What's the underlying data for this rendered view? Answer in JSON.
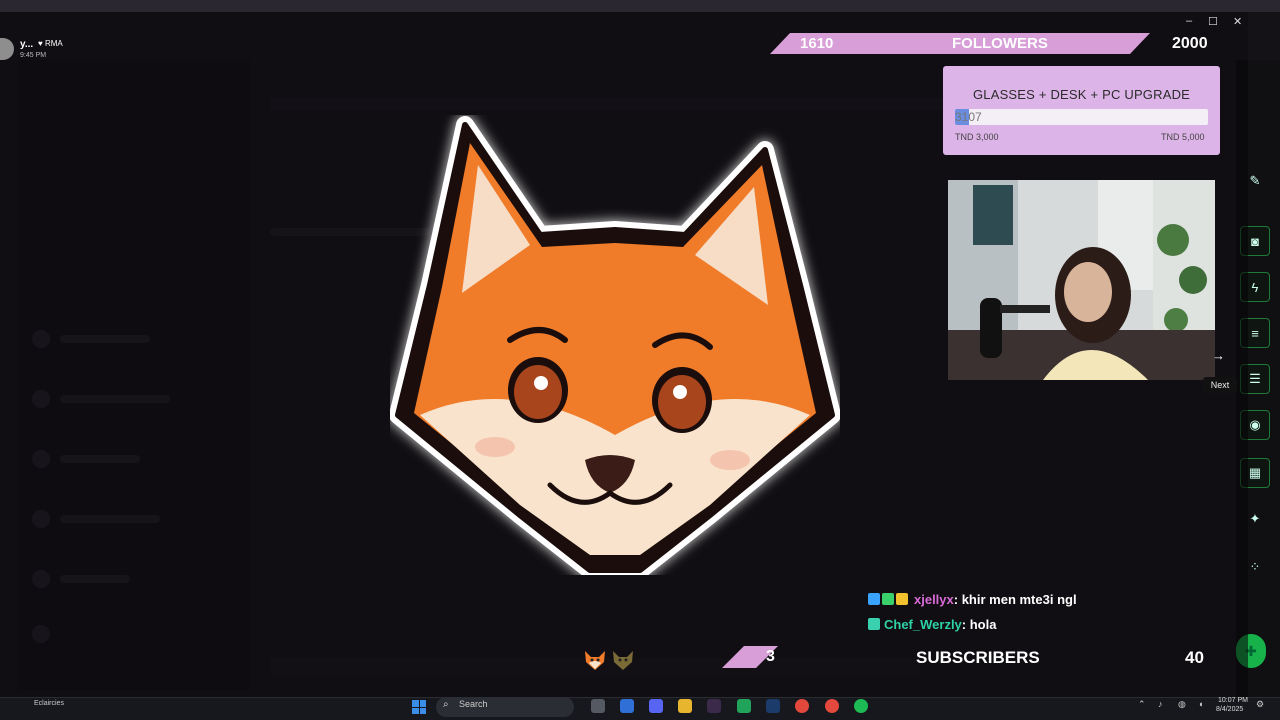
{
  "profile": {
    "name": "y...",
    "tag": "♥ RMA",
    "time": "9:45 PM"
  },
  "window_controls": {
    "minimize": "–",
    "maximize": "☐",
    "close": "✕"
  },
  "followers": {
    "current": "1610",
    "label": "FOLLOWERS",
    "goal": "2000",
    "color": "#d79ed8"
  },
  "goal_widget": {
    "title": "GLASSES + DESK + PC UPGRADE",
    "current": "3107",
    "progress": 0.0535,
    "min_label": "TND 3,000",
    "max_label": "TND 5,000",
    "bg": "#ddb4e8",
    "fill": "#6a8de0"
  },
  "webcam": {
    "next_label": "Next",
    "arrow": "→"
  },
  "chat": [
    {
      "user": "xjellyx",
      "message": ": khir men mte3i ngl",
      "user_color": "#d96bd7"
    },
    {
      "user": "Chef_Werzly",
      "message": ": hola",
      "user_color": "#2fd1a6"
    }
  ],
  "subscribers": {
    "current": "3",
    "label": "SUBSCRIBERS",
    "goal": "40"
  },
  "taskbar": {
    "weather": "Eclaircies",
    "search_placeholder": "Search",
    "clock_time": "10:07 PM",
    "clock_date": "8/4/2025"
  },
  "icons": {
    "search": "⌕",
    "right_rail": [
      "pencil-icon",
      "camera-icon",
      "bolt-icon",
      "notes-icon",
      "chat-icon",
      "broadcast-icon",
      "film-icon",
      "wrench-icon",
      "dots-icon"
    ]
  }
}
